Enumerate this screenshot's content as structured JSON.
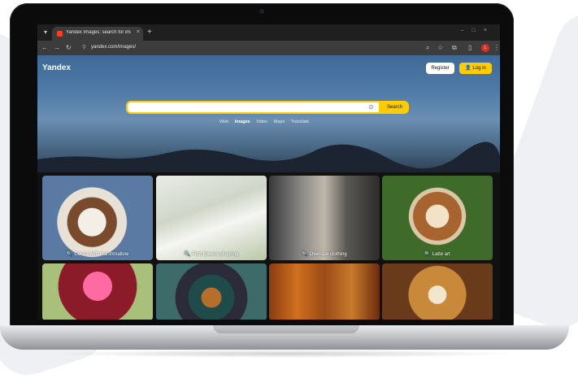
{
  "browser": {
    "tab_title": "Yandex Images: search for ima...",
    "tab_close": "×",
    "new_tab": "+",
    "url": "yandex.com/images/",
    "profile_initial": "L",
    "icons": [
      "back-arrow-icon",
      "forward-arrow-icon",
      "reload-icon",
      "site-info-icon",
      "search-icon",
      "star-icon",
      "extensions-icon",
      "sidebar-icon",
      "menu-icon"
    ]
  },
  "page": {
    "logo": "Yandex",
    "register": "Register",
    "login": "Log in",
    "search": {
      "value": "",
      "placeholder": "",
      "button": "Search"
    },
    "services": [
      "Web",
      "Images",
      "Video",
      "Maps",
      "Translate"
    ],
    "active_service": "Images",
    "tiles": [
      {
        "caption": "Cocoa with marshmallow"
      },
      {
        "caption": "First flowers of spring"
      },
      {
        "caption": "Oversize clothing"
      },
      {
        "caption": "Latte art"
      },
      {
        "caption": ""
      },
      {
        "caption": ""
      },
      {
        "caption": ""
      },
      {
        "caption": ""
      }
    ]
  },
  "colors": {
    "accent": "#ffcc00",
    "brand_red": "#fc3f1d"
  }
}
